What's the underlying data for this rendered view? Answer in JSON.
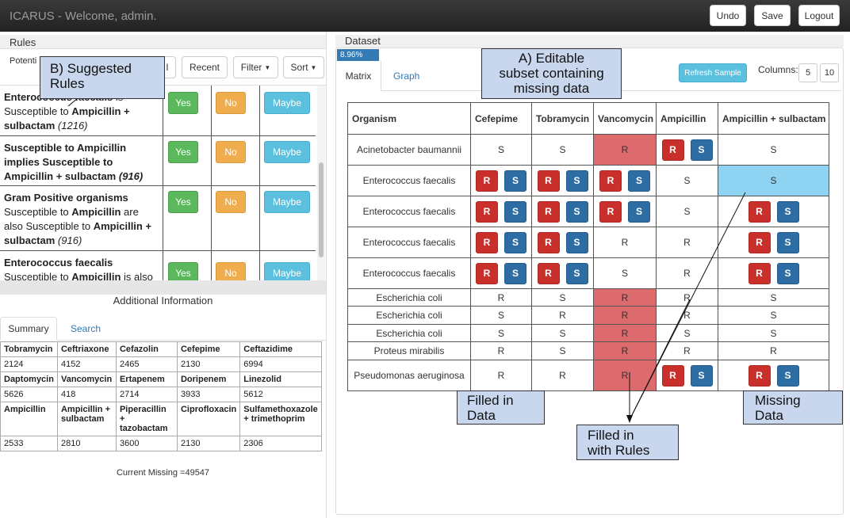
{
  "header": {
    "title": "ICARUS - Welcome, admin.",
    "buttons": {
      "undo": "Undo",
      "save": "Save",
      "logout": "Logout"
    }
  },
  "rules": {
    "heading": "Rules",
    "tab_potential": "Potenti",
    "tab_all_fragment": "l",
    "recent": "Recent",
    "filter": "Filter",
    "sort": "Sort",
    "yes": "Yes",
    "no": "No",
    "maybe": "Maybe",
    "items": [
      {
        "l1a": "Enterococcus faecalis",
        "l1b": " is",
        "l2a": "Susceptible to ",
        "l2b": "Ampicillin +",
        "l3a": "sulbactam",
        "l3b": " (1216)"
      },
      {
        "l1a": "Susceptible to Ampicillin",
        "l2a": "implies Susceptible to",
        "l3a": "Ampicillin + sulbactam",
        "l3b": " (916)"
      },
      {
        "l1a": "Gram Positive organisms",
        "l2a": "Susceptible to ",
        "l2b": "Ampicillin",
        "l2c": " are",
        "l3a": "also Susceptible to ",
        "l3b": "Ampicillin +",
        "l4a": "sulbactam",
        "l4b": " (916)"
      },
      {
        "l1a": "Enterococcus faecalis",
        "l2a": "Susceptible to ",
        "l2b": "Ampicillin",
        "l2c": " is also"
      }
    ]
  },
  "additional": {
    "title": "Additional Information",
    "tab_summary": "Summary",
    "tab_search": "Search",
    "table": [
      [
        "Tobramycin",
        "Ceftriaxone",
        "Cefazolin",
        "Cefepime",
        "Ceftazidime"
      ],
      [
        "2124",
        "4152",
        "2465",
        "2130",
        "6994"
      ],
      [
        "Daptomycin",
        "Vancomycin",
        "Ertapenem",
        "Doripenem",
        "Linezolid"
      ],
      [
        "5626",
        "418",
        "2714",
        "3933",
        "5612"
      ],
      [
        "Ampicillin",
        "Ampicillin + sulbactam",
        "Piperacillin + tazobactam",
        "Ciprofloxacin",
        "Sulfamethoxazole + trimethoprim"
      ],
      [
        "2533",
        "2810",
        "3600",
        "2130",
        "2306"
      ]
    ],
    "current_missing": "Current Missing =49547"
  },
  "dataset": {
    "heading": "Dataset",
    "percent": "8.96%",
    "tab_matrix": "Matrix",
    "tab_graph": "Graph",
    "refresh": "Refresh Sample",
    "columns_label": "Columns:",
    "col_5": "5",
    "col_10": "10",
    "headers": [
      "Organism",
      "Cefepime",
      "Tobramycin",
      "Vancomycin",
      "Ampicillin",
      "Ampicillin + sulbactam"
    ],
    "r": "R",
    "s": "S",
    "rows": [
      {
        "org": "Acinetobacter baumannii",
        "cells": [
          "S",
          "S",
          "R",
          "RS",
          "S"
        ],
        "fill": [
          "",
          "",
          "red",
          "",
          ""
        ]
      },
      {
        "org": "Enterococcus faecalis",
        "cells": [
          "RS",
          "RS",
          "RS",
          "S",
          "S"
        ],
        "fill": [
          "",
          "",
          "",
          "",
          "blue"
        ]
      },
      {
        "org": "Enterococcus faecalis",
        "cells": [
          "RS",
          "RS",
          "RS",
          "S",
          "RS"
        ],
        "fill": [
          "",
          "",
          "",
          "",
          ""
        ]
      },
      {
        "org": "Enterococcus faecalis",
        "cells": [
          "RS",
          "RS",
          "R",
          "R",
          "RS"
        ],
        "fill": [
          "",
          "",
          "",
          "",
          ""
        ]
      },
      {
        "org": "Enterococcus faecalis",
        "cells": [
          "RS",
          "RS",
          "S",
          "R",
          "RS"
        ],
        "fill": [
          "",
          "",
          "",
          "",
          ""
        ]
      },
      {
        "org": "Escherichia coli",
        "cells": [
          "R",
          "S",
          "R",
          "R",
          "S"
        ],
        "fill": [
          "",
          "",
          "red",
          "",
          ""
        ]
      },
      {
        "org": "Escherichia coli",
        "cells": [
          "S",
          "R",
          "R",
          "R",
          "S"
        ],
        "fill": [
          "",
          "",
          "red",
          "",
          ""
        ]
      },
      {
        "org": "Escherichia coli",
        "cells": [
          "S",
          "S",
          "R",
          "S",
          "S"
        ],
        "fill": [
          "",
          "",
          "red",
          "",
          ""
        ]
      },
      {
        "org": "Proteus mirabilis",
        "cells": [
          "R",
          "S",
          "R",
          "R",
          "R"
        ],
        "fill": [
          "",
          "",
          "red",
          "",
          ""
        ]
      },
      {
        "org": "Pseudomonas aeruginosa",
        "cells": [
          "R",
          "R",
          "R",
          "RS",
          "RS"
        ],
        "fill": [
          "",
          "",
          "red",
          "",
          ""
        ]
      }
    ]
  },
  "annotations": {
    "a": [
      "A) Editable",
      "subset containing",
      "missing data"
    ],
    "b": [
      "B) Suggested",
      "Rules"
    ],
    "filled_data": [
      "Filled in",
      "Data"
    ],
    "filled_rules": [
      "Filled in",
      "with Rules"
    ],
    "missing": [
      "Missing",
      "Data"
    ]
  }
}
